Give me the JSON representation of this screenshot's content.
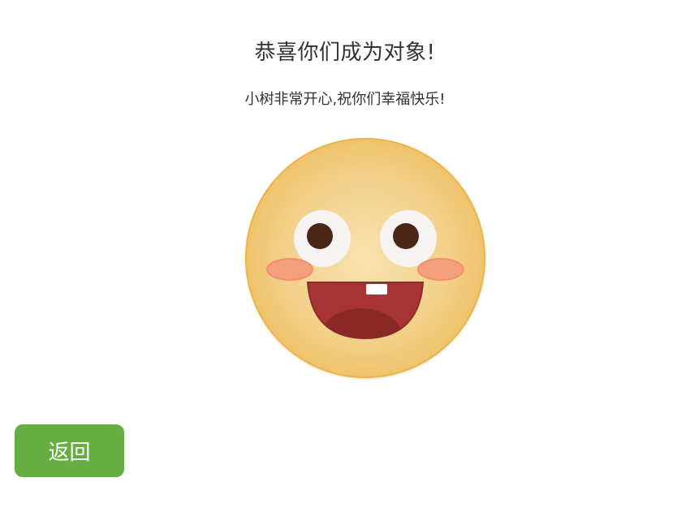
{
  "header": {
    "title": "恭喜你们成为对象!",
    "subtitle": "小树非常开心,祝你们幸福快乐!"
  },
  "illustration": {
    "icon": "happy-face-icon",
    "colors": {
      "face_center": "#f7dfa8",
      "face_edge": "#efc46e",
      "face_border": "#e9b447",
      "eye_white": "#f6f4f2",
      "pupil": "#4a2616",
      "cheek": "#f5a07d",
      "mouth": "#a33434",
      "tongue": "#8a2a2a",
      "tooth": "#ffffff"
    }
  },
  "actions": {
    "back_label": "返回",
    "back_color": "#66ad43"
  }
}
